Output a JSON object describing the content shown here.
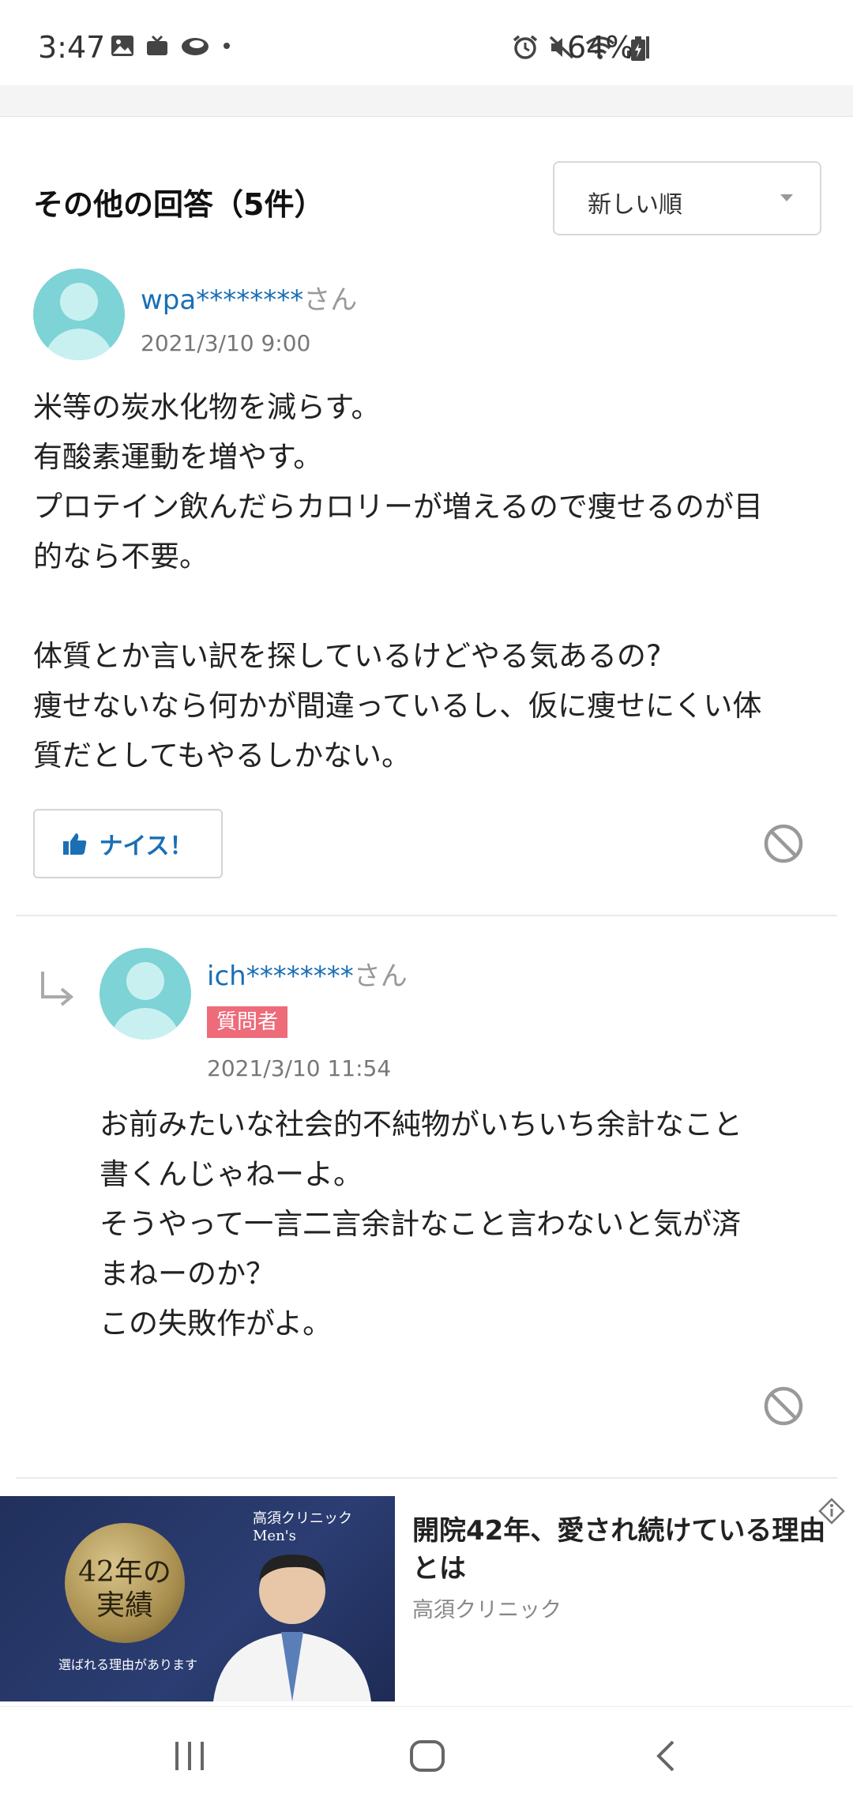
{
  "status_bar": {
    "time": "3:47",
    "battery_percent": "64%",
    "left_icons": [
      "gallery-icon",
      "tv-icon",
      "cloud-icon",
      "dot-icon"
    ],
    "right_icons": [
      "alarm-icon",
      "mute-icon",
      "wifi-icon",
      "signal-icon",
      "battery-icon"
    ]
  },
  "section": {
    "title": "その他の回答（5件）",
    "sort_label": "新しい順"
  },
  "answer": {
    "username": "wpa********",
    "honorific": "さん",
    "date": "2021/3/10 9:00",
    "body": "米等の炭水化物を減らす。\n有酸素運動を増やす。\nプロテイン飲んだらカロリーが増えるので痩せるのが目\n的なら不要。\n\n体質とか言い訳を探しているけどやる気あるの?\n痩せないなら何かが間違っているし、仮に痩せにくい体\n質だとしてもやるしかない。",
    "nice_label": "ナイス！"
  },
  "reply": {
    "username": "ich********",
    "honorific": "さん",
    "badge": "質問者",
    "date": "2021/3/10 11:54",
    "body": "お前みたいな社会的不純物がいちいち余計なこと\n書くんじゃねーよ。\nそうやって一言二言余計なこと言わないと気が済\nまねーのか？\nこの失敗作がよ。"
  },
  "ad": {
    "brand": "高須クリニック  Men's",
    "medal_text": "42年の\n実績",
    "tagline": "選ばれる理由があります",
    "title": "開院42年、愛され続けている理由とは",
    "source": "高須クリニック"
  },
  "colors": {
    "link_blue": "#1a6fb5",
    "avatar_teal": "#7dd3d6",
    "badge_pink": "#ee6b7a"
  }
}
